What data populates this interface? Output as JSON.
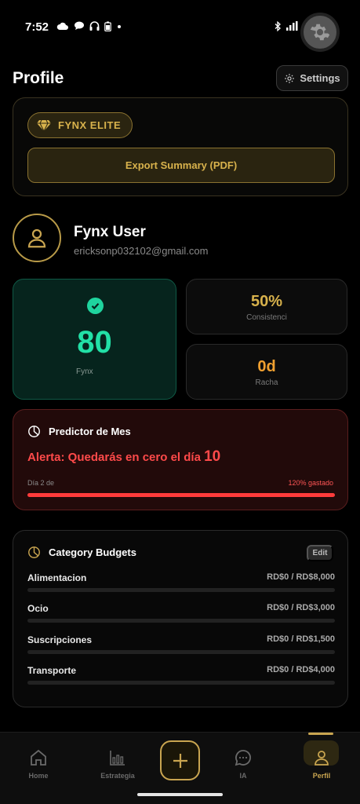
{
  "status": {
    "time": "7:52",
    "left_icons": [
      "cloud-icon",
      "chat-icon",
      "headphones-icon",
      "battery-icon",
      "dot-icon"
    ],
    "right_icons": [
      "bluetooth-icon",
      "signal-icon",
      "wifi-icon",
      "battery-icon"
    ]
  },
  "header": {
    "title": "Profile",
    "settings_label": "Settings"
  },
  "elite": {
    "badge_label": "FYNX ELITE",
    "export_label": "Export Summary (PDF)"
  },
  "user": {
    "name": "Fynx User",
    "email": "ericksonp032102@gmail.com"
  },
  "stats": {
    "score_value": "80",
    "score_label": "Fynx",
    "consistency_value": "50%",
    "consistency_label": "Consistenci",
    "streak_value": "0d",
    "streak_label": "Racha"
  },
  "predictor": {
    "title": "Predictor de Mes",
    "alert_prefix": "Alerta: Quedarás en cero el día ",
    "alert_day": "10",
    "day_label": "Día 2 de",
    "spent_label": "120% gastado",
    "spent_fraction": 1.0
  },
  "budgets": {
    "title": "Category Budgets",
    "edit_label": "Edit",
    "items": [
      {
        "name": "Alimentacion",
        "amount": "RD$0 / RD$8,000"
      },
      {
        "name": "Ocio",
        "amount": "RD$0 / RD$3,000"
      },
      {
        "name": "Suscripciones",
        "amount": "RD$0 / RD$1,500"
      },
      {
        "name": "Transporte",
        "amount": "RD$0 / RD$4,000"
      }
    ]
  },
  "nav": {
    "home": "Home",
    "strategy": "Estrategia",
    "ai": "IA",
    "profile": "Perfil"
  },
  "colors": {
    "accent_gold": "#c9a550",
    "score_green": "#22e0a6",
    "alert_red": "#ff4a4a",
    "streak_orange": "#f0a030"
  }
}
